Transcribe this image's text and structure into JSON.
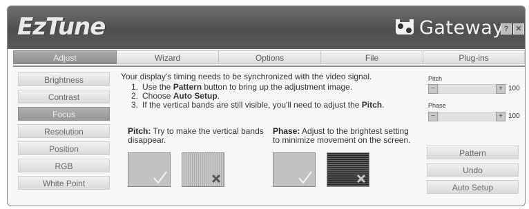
{
  "app": {
    "logo": "EzTune",
    "brand": "Gateway",
    "help_label": "?",
    "close_label": "✕"
  },
  "tabs": [
    "Adjust",
    "Wizard",
    "Options",
    "File",
    "Plug-ins"
  ],
  "active_tab": "Adjust",
  "sidebar": {
    "items": [
      "Brightness",
      "Contrast",
      "Focus",
      "Resolution",
      "Position",
      "RGB",
      "White Point"
    ],
    "active": "Focus"
  },
  "main": {
    "intro": "Your display's timing needs to be synchronized with the video signal.",
    "steps": [
      {
        "num": "1.",
        "pre": "Use the ",
        "bold": "Pattern",
        "post": " button to bring up the adjustment image."
      },
      {
        "num": "2.",
        "pre": "Choose ",
        "bold": "Auto Setup",
        "post": "."
      },
      {
        "num": "3.",
        "pre": "If the vertical bands are still visible, you'll need to adjust the ",
        "bold": "Pitch",
        "post": "."
      }
    ],
    "pitch_heading": "Pitch:",
    "pitch_line1": "Try to make the vertical bands",
    "pitch_line2": "disappear.",
    "phase_heading": "Phase:",
    "phase_line1": "Adjust to the brightest setting",
    "phase_line2": "to minimize movement on the screen."
  },
  "controls": {
    "pitch_label": "Pitch",
    "pitch_value": "100",
    "phase_label": "Phase",
    "phase_value": "100",
    "minus": "−",
    "plus": "+"
  },
  "buttons": {
    "pattern": "Pattern",
    "undo": "Undo",
    "auto_setup": "Auto Setup"
  },
  "icons": {
    "good": "checkmark-icon",
    "bad": "x-mark-icon"
  }
}
